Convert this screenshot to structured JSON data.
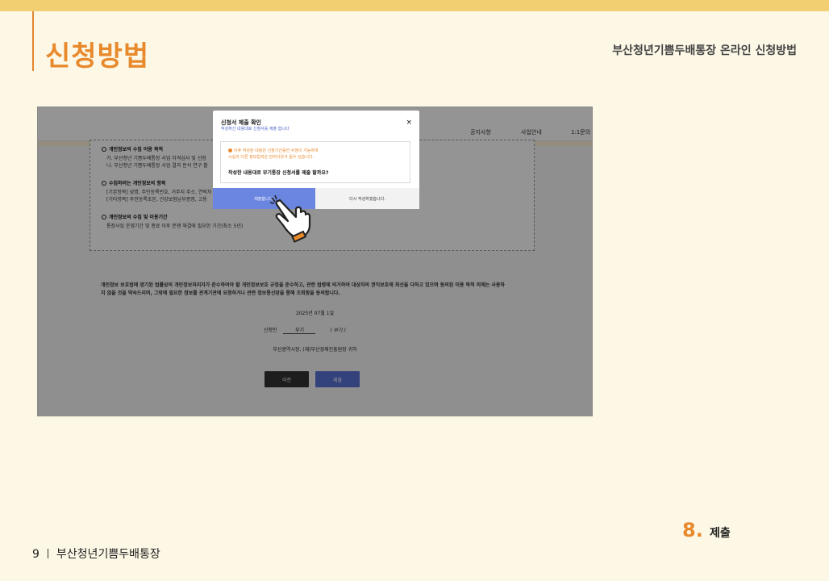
{
  "header": {
    "title": "신청방법",
    "subtitle": "부산청년기쁨두배통장 온라인 신청방법"
  },
  "screenshot": {
    "nav": [
      "공지사항",
      "사업안내",
      "1:1문의"
    ],
    "consent": {
      "purpose_title": "개인정보의 수집 이용 목적",
      "purpose_line1": "가. 부산청년 기쁨두배통장 사업 자격심사 및 선정",
      "purpose_line2": "나. 부산청년 기쁨두배통장 사업 결과 분석 연구 활",
      "items_title": "수집하려는 개인정보의 항목",
      "items_line1": "[기본항목] 성명, 주민등록번호, 거주지 주소, 연락처",
      "items_line2": "[기타항목] 주민등록초본, 건강보험납부증명, 고용",
      "period_title": "개인정보의 수집 및 이용기간",
      "period_line1": "통장사업 운영기간 및 종료 이후 분쟁 해결에 필요한 기간(최소 5년)"
    },
    "agreement_line1": "개인정보 보호법에 명기된 법률상의 개인정보처리자가 준수하여야 할 개인정보보호 규정을 준수하고, 관련 법령에 의거하여 대상자의 권익보호에 최선을 다하고 있으며 동의된 이용 목적 외에는 사용하",
    "agreement_line2": "지 않을 것을 약속드리며, 그밖에 필요한 정보를 관계기관에 요청하거나 관련 정보통신망을 통해 조회함을 동의합니다.",
    "date": "2025년 07월 1일",
    "applicant_label": "신청인",
    "applicant_name": "부기",
    "signature": "( 부기 )",
    "recipient": "부산광역시장, (재)부산경제진흥원장 귀하",
    "prev_button": "이전",
    "submit_button": "제출"
  },
  "modal": {
    "title": "신청서 제출 확인",
    "subtitle": "작성하신 내용대로 신청서를 제출 합니다",
    "close": "×",
    "warning_line1": "이후 작성된 내용은 신청기간동안 수정이 가능하며",
    "warning_line2": "시실과 다른 정보입력은 반려사유가 될수 있습니다.",
    "question": "작성한 내용대로 부기통장 신청서를 제출 할까요?",
    "confirm": "제출합니다.",
    "rewrite": "다시 작성하겠습니다."
  },
  "step": {
    "number": "8.",
    "label": "제출"
  },
  "footer": {
    "page_number": "9",
    "name": "부산청년기쁨두배통장"
  },
  "colors": {
    "accent": "#e8892c",
    "top_band": "#f2cf70",
    "background": "#fdf8e6",
    "confirm_button": "#6b86e0"
  },
  "icons": {
    "pointer": "pointing-hand-icon"
  }
}
